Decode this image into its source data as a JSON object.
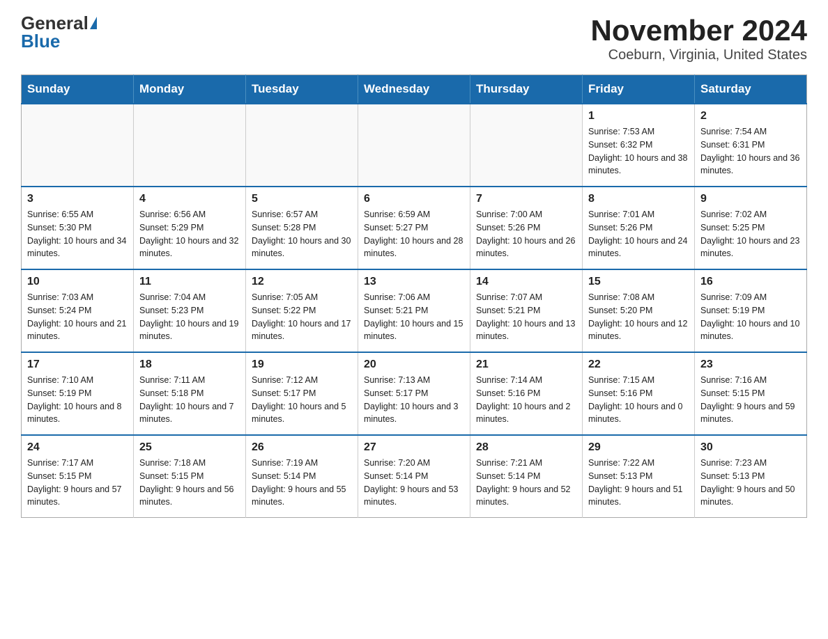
{
  "logo": {
    "general": "General",
    "blue": "Blue"
  },
  "title": "November 2024",
  "subtitle": "Coeburn, Virginia, United States",
  "days_of_week": [
    "Sunday",
    "Monday",
    "Tuesday",
    "Wednesday",
    "Thursday",
    "Friday",
    "Saturday"
  ],
  "weeks": [
    [
      {
        "day": "",
        "info": ""
      },
      {
        "day": "",
        "info": ""
      },
      {
        "day": "",
        "info": ""
      },
      {
        "day": "",
        "info": ""
      },
      {
        "day": "",
        "info": ""
      },
      {
        "day": "1",
        "info": "Sunrise: 7:53 AM\nSunset: 6:32 PM\nDaylight: 10 hours and 38 minutes."
      },
      {
        "day": "2",
        "info": "Sunrise: 7:54 AM\nSunset: 6:31 PM\nDaylight: 10 hours and 36 minutes."
      }
    ],
    [
      {
        "day": "3",
        "info": "Sunrise: 6:55 AM\nSunset: 5:30 PM\nDaylight: 10 hours and 34 minutes."
      },
      {
        "day": "4",
        "info": "Sunrise: 6:56 AM\nSunset: 5:29 PM\nDaylight: 10 hours and 32 minutes."
      },
      {
        "day": "5",
        "info": "Sunrise: 6:57 AM\nSunset: 5:28 PM\nDaylight: 10 hours and 30 minutes."
      },
      {
        "day": "6",
        "info": "Sunrise: 6:59 AM\nSunset: 5:27 PM\nDaylight: 10 hours and 28 minutes."
      },
      {
        "day": "7",
        "info": "Sunrise: 7:00 AM\nSunset: 5:26 PM\nDaylight: 10 hours and 26 minutes."
      },
      {
        "day": "8",
        "info": "Sunrise: 7:01 AM\nSunset: 5:26 PM\nDaylight: 10 hours and 24 minutes."
      },
      {
        "day": "9",
        "info": "Sunrise: 7:02 AM\nSunset: 5:25 PM\nDaylight: 10 hours and 23 minutes."
      }
    ],
    [
      {
        "day": "10",
        "info": "Sunrise: 7:03 AM\nSunset: 5:24 PM\nDaylight: 10 hours and 21 minutes."
      },
      {
        "day": "11",
        "info": "Sunrise: 7:04 AM\nSunset: 5:23 PM\nDaylight: 10 hours and 19 minutes."
      },
      {
        "day": "12",
        "info": "Sunrise: 7:05 AM\nSunset: 5:22 PM\nDaylight: 10 hours and 17 minutes."
      },
      {
        "day": "13",
        "info": "Sunrise: 7:06 AM\nSunset: 5:21 PM\nDaylight: 10 hours and 15 minutes."
      },
      {
        "day": "14",
        "info": "Sunrise: 7:07 AM\nSunset: 5:21 PM\nDaylight: 10 hours and 13 minutes."
      },
      {
        "day": "15",
        "info": "Sunrise: 7:08 AM\nSunset: 5:20 PM\nDaylight: 10 hours and 12 minutes."
      },
      {
        "day": "16",
        "info": "Sunrise: 7:09 AM\nSunset: 5:19 PM\nDaylight: 10 hours and 10 minutes."
      }
    ],
    [
      {
        "day": "17",
        "info": "Sunrise: 7:10 AM\nSunset: 5:19 PM\nDaylight: 10 hours and 8 minutes."
      },
      {
        "day": "18",
        "info": "Sunrise: 7:11 AM\nSunset: 5:18 PM\nDaylight: 10 hours and 7 minutes."
      },
      {
        "day": "19",
        "info": "Sunrise: 7:12 AM\nSunset: 5:17 PM\nDaylight: 10 hours and 5 minutes."
      },
      {
        "day": "20",
        "info": "Sunrise: 7:13 AM\nSunset: 5:17 PM\nDaylight: 10 hours and 3 minutes."
      },
      {
        "day": "21",
        "info": "Sunrise: 7:14 AM\nSunset: 5:16 PM\nDaylight: 10 hours and 2 minutes."
      },
      {
        "day": "22",
        "info": "Sunrise: 7:15 AM\nSunset: 5:16 PM\nDaylight: 10 hours and 0 minutes."
      },
      {
        "day": "23",
        "info": "Sunrise: 7:16 AM\nSunset: 5:15 PM\nDaylight: 9 hours and 59 minutes."
      }
    ],
    [
      {
        "day": "24",
        "info": "Sunrise: 7:17 AM\nSunset: 5:15 PM\nDaylight: 9 hours and 57 minutes."
      },
      {
        "day": "25",
        "info": "Sunrise: 7:18 AM\nSunset: 5:15 PM\nDaylight: 9 hours and 56 minutes."
      },
      {
        "day": "26",
        "info": "Sunrise: 7:19 AM\nSunset: 5:14 PM\nDaylight: 9 hours and 55 minutes."
      },
      {
        "day": "27",
        "info": "Sunrise: 7:20 AM\nSunset: 5:14 PM\nDaylight: 9 hours and 53 minutes."
      },
      {
        "day": "28",
        "info": "Sunrise: 7:21 AM\nSunset: 5:14 PM\nDaylight: 9 hours and 52 minutes."
      },
      {
        "day": "29",
        "info": "Sunrise: 7:22 AM\nSunset: 5:13 PM\nDaylight: 9 hours and 51 minutes."
      },
      {
        "day": "30",
        "info": "Sunrise: 7:23 AM\nSunset: 5:13 PM\nDaylight: 9 hours and 50 minutes."
      }
    ]
  ]
}
